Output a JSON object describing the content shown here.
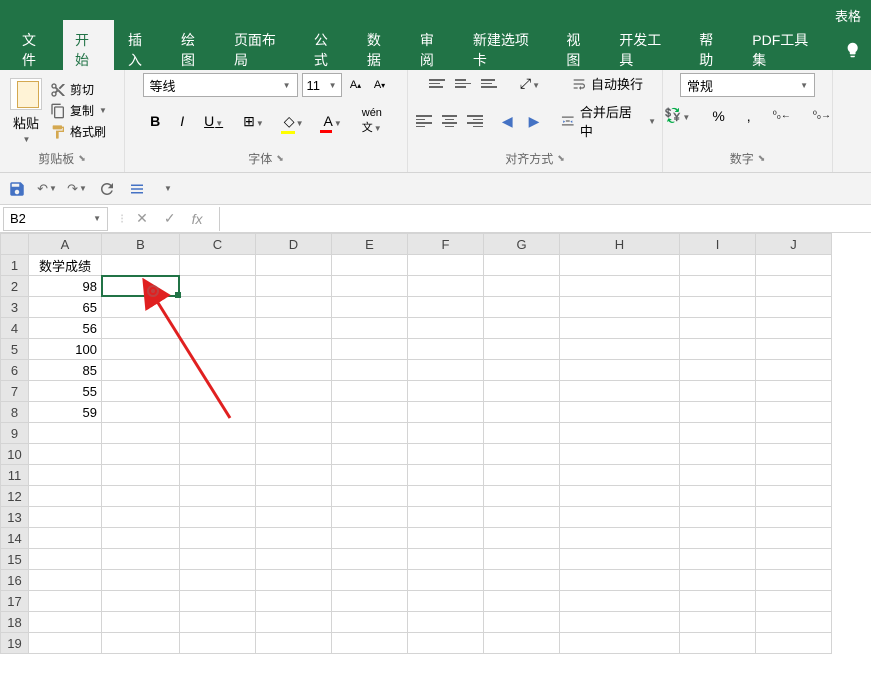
{
  "title": "表格",
  "menu": {
    "file": "文件",
    "home": "开始",
    "insert": "插入",
    "draw": "绘图",
    "layout": "页面布局",
    "formulas": "公式",
    "data": "数据",
    "review": "审阅",
    "newtab": "新建选项卡",
    "view": "视图",
    "developer": "开发工具",
    "help": "帮助",
    "pdf": "PDF工具集"
  },
  "ribbon": {
    "clipboard": {
      "paste": "粘贴",
      "cut": "剪切",
      "copy": "复制",
      "format_painter": "格式刷",
      "label": "剪贴板"
    },
    "font": {
      "name": "等线",
      "size": "11",
      "label": "字体"
    },
    "alignment": {
      "wrap": "自动换行",
      "merge": "合并后居中",
      "label": "对齐方式"
    },
    "number": {
      "format": "常规",
      "label": "数字"
    }
  },
  "name_box": "B2",
  "grid": {
    "columns": [
      "A",
      "B",
      "C",
      "D",
      "E",
      "F",
      "G",
      "H",
      "I",
      "J"
    ],
    "rows": [
      1,
      2,
      3,
      4,
      5,
      6,
      7,
      8,
      9,
      10,
      11,
      12,
      13,
      14,
      15,
      16,
      17,
      18,
      19
    ],
    "data": {
      "A1": "数学成绩",
      "A2": "98",
      "A3": "65",
      "A4": "56",
      "A5": "100",
      "A6": "85",
      "A7": "55",
      "A8": "59"
    }
  }
}
